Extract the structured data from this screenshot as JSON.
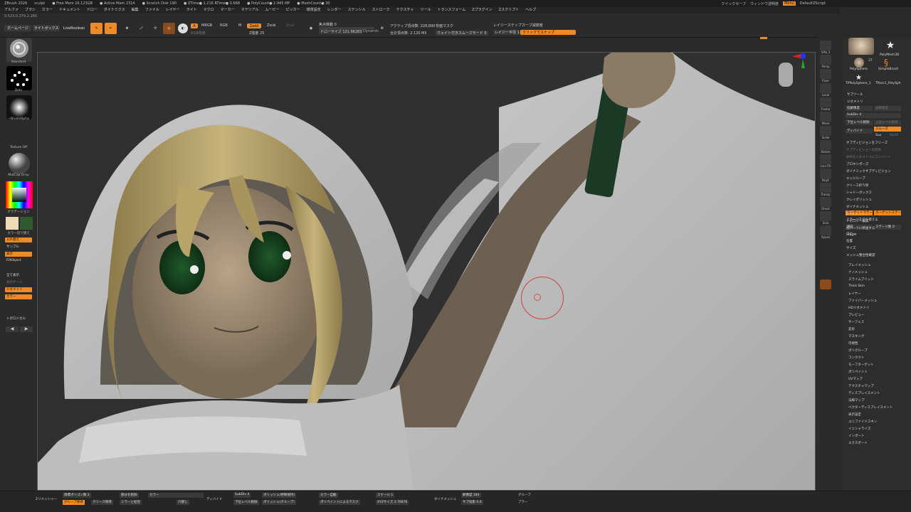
{
  "titlebar": {
    "app": "ZBrush 2026",
    "doc": "sculpt",
    "stats": [
      "● Free Mem 16.123GB",
      "● Active Mem 2314",
      "● Scratch Disk 190",
      "● ZTime● 1.216 RTime● 0.668",
      "● PolyCount● 2.945 MP",
      "● MeshCount● 30"
    ],
    "quicksave": "クイックセーブ",
    "transparency": "ウィンドウ透明度",
    "menu_label": "Menu",
    "script": "DefaultZScript"
  },
  "menubar": [
    "アルファ",
    "ブラシ",
    "カラー",
    "ドキュメント",
    "ドロー",
    "ダイナミクス",
    "編集",
    "ファイル",
    "レイヤー",
    "ライト",
    "マクロ",
    "マーカー",
    "マテリアル",
    "ムービー",
    "ピッカー",
    "環境設定",
    "レンダー",
    "ステンシル",
    "ストローク",
    "テクスチャ",
    "ツール",
    "トランスフォーム",
    "Zプラグイン",
    "Zスクリプト",
    "ヘルプ"
  ],
  "coords": "0.523,0.379,2.265",
  "topshelf": {
    "home": "ホームページ",
    "lightbox": "ライトボックス",
    "liveboolean": "LiveBoolean",
    "edit": "Edit",
    "draw": "Draw",
    "move": "Move",
    "scale": "Scale",
    "rotate": "Rotate",
    "a": "A",
    "mrgb": "MRGB",
    "rgb": "RGB",
    "m": "M",
    "zadd": "Zadd",
    "zsub": "Zsub",
    "zcut": "Zcut",
    "rgb_intensity": "RGB強度",
    "z_intensity": "Z強度 25",
    "focal_shift": "焦点移動 0",
    "draw_size": "ドローサイズ 131.96283",
    "dynamic": "Dynamic",
    "active_points": "アクティブ頂点数: 228,890",
    "total_points": "合計頂点数: 2.120 Mil",
    "backface": "背面マスク",
    "weighted_smooth": "ウェイト付きスムーズモード 0",
    "layer_step": "レイジーステップ",
    "curve_falloff": "カーブ減衰度",
    "lazy_radius": "レイジー半径 1",
    "lazy_snap": "クリックでスナップ"
  },
  "leftbar": {
    "brush": "Standard",
    "stroke": "Dots",
    "alpha": "~BrushAlpha",
    "texture": "Texture Off",
    "material": "MatCap Gray",
    "gradient": "グラデーション",
    "switch_color": "カラー切り替え",
    "alternate": "入れ替え",
    "samples": "サンプル",
    "display": "表示",
    "fill": "FillObject",
    "full_display": "全て表示",
    "display_2": "表示ゲージ",
    "geometry": "ジオメトリ",
    "color": "カラー",
    "topological": "トポロジカル"
  },
  "rightstrip": [
    "SPix 3",
    "Persp",
    "Floor",
    "Local",
    "Frame",
    "Move",
    "Scale",
    "Rotate",
    "Line Fill",
    "PolyF",
    "Transp",
    "Ghost",
    "Solo",
    "Xpose"
  ],
  "rightpanel": {
    "tool_thumbs": [
      "PolySphere",
      "PolyMesh3D",
      "PolySphere",
      "SimpleBrush",
      "TPPolySphere_1",
      "TPoss1_PolySph"
    ],
    "count": "37",
    "subtool": "サブツール",
    "geometry": "ジオメトリ",
    "lower_res": "低解像度",
    "higher_res": "高解像度",
    "subdiv": "SubDiv 4",
    "delete_lower": "下位レベル削除",
    "delete_higher": "上位レベル削除",
    "divide": "ディバイド",
    "smooth": "スムーズ",
    "suv": "Suv",
    "relax": "ReUV",
    "freeze": "サブディビジョンをフリーズ",
    "items": [
      "プロキシポーズ",
      "ダイナミックサブディビジョン",
      "エッジループ",
      "クリース折り目",
      "シャドーボックス",
      "クレイポリッシュ",
      "ダイナメッシュ",
      "Zリメッシャー",
      "トポロジー編集",
      "別パーツに移送する",
      "Stager"
    ],
    "target_stage": "ターゲットステージ",
    "reset": "ステージを切り替える",
    "home_stage": "現在",
    "stage_count": "ステージ数 0",
    "copy": "コピー",
    "position": "位置",
    "size": "サイズ",
    "mesh_integrity": "メッシュ整合性確認",
    "sections": [
      "アレイメッシュ",
      "ナノメッシュ",
      "スライムブリッジ",
      "Thick Skin",
      "レイヤー",
      "ファイバーメッシュ",
      "HDジオメトリ",
      "プレビュー",
      "サーフェス",
      "変形",
      "マスキング",
      "可視性",
      "ポリグループ",
      "コンタクト",
      "モーフターゲット",
      "ポリペイント",
      "UVマップ",
      "テクスチャマップ",
      "ディスプレイスメント",
      "法線マップ",
      "ベクターディスプレイスメント",
      "表示設定",
      "ユニファイドスキン",
      "イニシャライズ",
      "インポート",
      "エクスポート"
    ]
  },
  "bottombar": {
    "zremesh": "Zリメッシャー",
    "target_poly": "目標ポリゴン数 2",
    "polygroups": "グループ保持",
    "keep_crease": "クリース保持",
    "delete_all": "部分を削除",
    "color_split": "カラー",
    "mirror_weld": "ミラーと結合",
    "close_holes": "穴閉じ",
    "divide": "ディバイド",
    "subdiv": "SubDiv 4",
    "polish_feature": "ポリッシュ(特徴保持)",
    "delete_lower": "下位レベル削除",
    "polish_group": "ポリッシュ(グループ)",
    "color_fill": "カラー自動",
    "polypaint_mask": "ポリペイントによるマスク",
    "scale": "スケール 1",
    "xy_size": "XYZサイズ 2.76876",
    "dynamesh": "ダイナメッシュ",
    "resolution": "解像度 184",
    "sub_projection": "サブ投影 0.6",
    "groups": "グループ",
    "blur": "ブラー"
  },
  "colors": {
    "accent": "#f08a24",
    "primary_color": "#f0d9b5",
    "secondary_color": "#2f5a2f"
  }
}
